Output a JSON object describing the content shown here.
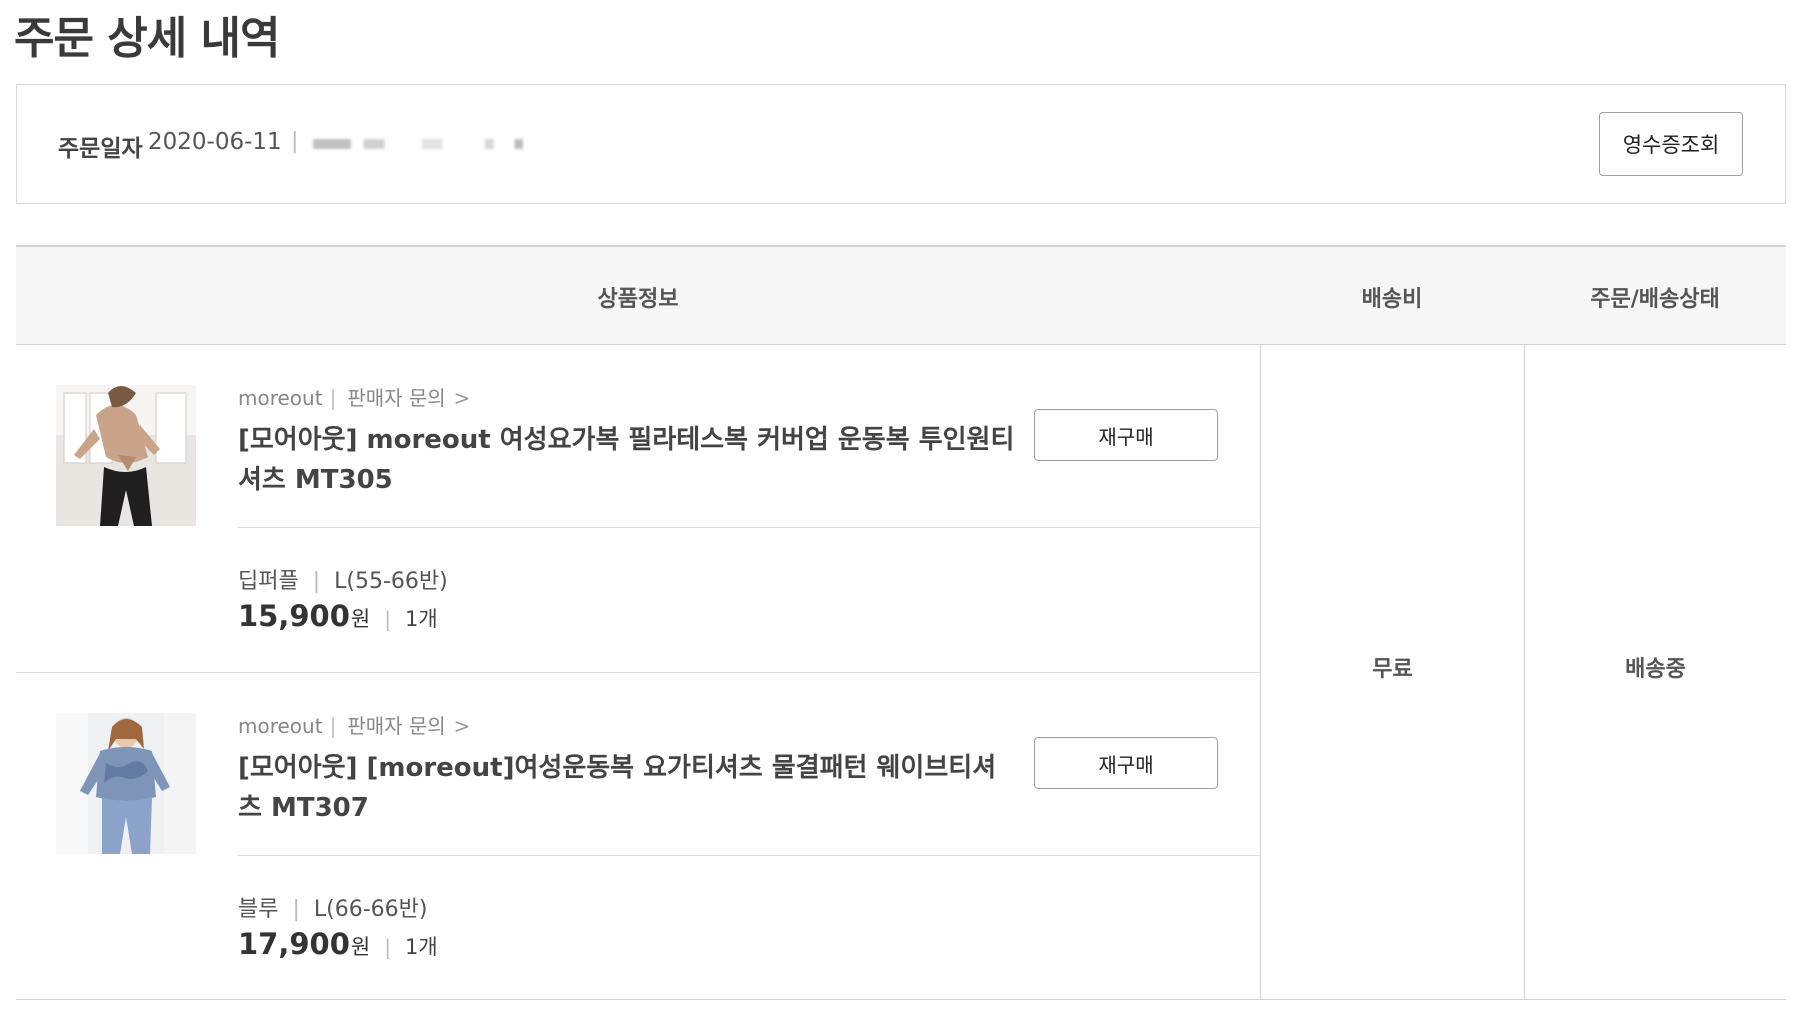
{
  "page": {
    "title": "주문 상세 내역"
  },
  "order": {
    "date_label": "주문일자",
    "date": "2020-06-11",
    "separator": "|",
    "receipt_button": "영수증조회"
  },
  "table": {
    "headers": {
      "product": "상품정보",
      "shipping": "배송비",
      "status": "주문/배송상태"
    },
    "shipping_fee": "무료",
    "order_status": "배송중",
    "items": [
      {
        "seller": "moreout",
        "inquiry": "판매자 문의",
        "name": "[모어아웃] moreout 여성요가복 필라테스복 커버업 운동복 투인원티셔츠 MT305",
        "rebuy": "재구매",
        "color": "딥퍼플",
        "size": "L(55-66반)",
        "price": "15,900",
        "currency": "원",
        "quantity": "1개"
      },
      {
        "seller": "moreout",
        "inquiry": "판매자 문의",
        "name": "[모어아웃] [moreout]여성운동복 요가티셔츠 물결패턴 웨이브티셔츠 MT307",
        "rebuy": "재구매",
        "color": "블루",
        "size": "L(66-66반)",
        "price": "17,900",
        "currency": "원",
        "quantity": "1개"
      }
    ]
  },
  "colors": {
    "header_bg": "#f7f7f7",
    "border": "#d3d3d3",
    "text": "#333333"
  }
}
